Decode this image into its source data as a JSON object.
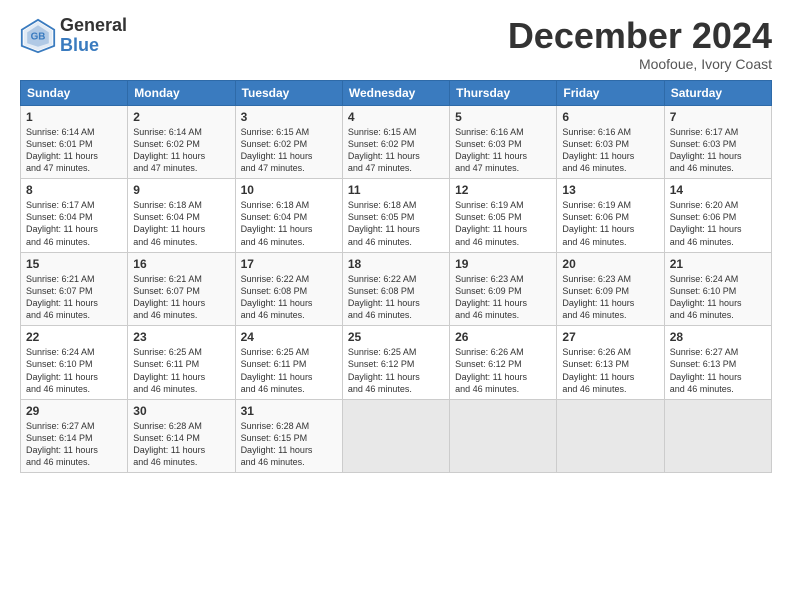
{
  "logo": {
    "general": "General",
    "blue": "Blue"
  },
  "title": "December 2024",
  "subtitle": "Moofoue, Ivory Coast",
  "days_of_week": [
    "Sunday",
    "Monday",
    "Tuesday",
    "Wednesday",
    "Thursday",
    "Friday",
    "Saturday"
  ],
  "weeks": [
    [
      {
        "day": 1,
        "info": "Sunrise: 6:14 AM\nSunset: 6:01 PM\nDaylight: 11 hours\nand 47 minutes."
      },
      {
        "day": 2,
        "info": "Sunrise: 6:14 AM\nSunset: 6:02 PM\nDaylight: 11 hours\nand 47 minutes."
      },
      {
        "day": 3,
        "info": "Sunrise: 6:15 AM\nSunset: 6:02 PM\nDaylight: 11 hours\nand 47 minutes."
      },
      {
        "day": 4,
        "info": "Sunrise: 6:15 AM\nSunset: 6:02 PM\nDaylight: 11 hours\nand 47 minutes."
      },
      {
        "day": 5,
        "info": "Sunrise: 6:16 AM\nSunset: 6:03 PM\nDaylight: 11 hours\nand 47 minutes."
      },
      {
        "day": 6,
        "info": "Sunrise: 6:16 AM\nSunset: 6:03 PM\nDaylight: 11 hours\nand 46 minutes."
      },
      {
        "day": 7,
        "info": "Sunrise: 6:17 AM\nSunset: 6:03 PM\nDaylight: 11 hours\nand 46 minutes."
      }
    ],
    [
      {
        "day": 8,
        "info": "Sunrise: 6:17 AM\nSunset: 6:04 PM\nDaylight: 11 hours\nand 46 minutes."
      },
      {
        "day": 9,
        "info": "Sunrise: 6:18 AM\nSunset: 6:04 PM\nDaylight: 11 hours\nand 46 minutes."
      },
      {
        "day": 10,
        "info": "Sunrise: 6:18 AM\nSunset: 6:04 PM\nDaylight: 11 hours\nand 46 minutes."
      },
      {
        "day": 11,
        "info": "Sunrise: 6:18 AM\nSunset: 6:05 PM\nDaylight: 11 hours\nand 46 minutes."
      },
      {
        "day": 12,
        "info": "Sunrise: 6:19 AM\nSunset: 6:05 PM\nDaylight: 11 hours\nand 46 minutes."
      },
      {
        "day": 13,
        "info": "Sunrise: 6:19 AM\nSunset: 6:06 PM\nDaylight: 11 hours\nand 46 minutes."
      },
      {
        "day": 14,
        "info": "Sunrise: 6:20 AM\nSunset: 6:06 PM\nDaylight: 11 hours\nand 46 minutes."
      }
    ],
    [
      {
        "day": 15,
        "info": "Sunrise: 6:21 AM\nSunset: 6:07 PM\nDaylight: 11 hours\nand 46 minutes."
      },
      {
        "day": 16,
        "info": "Sunrise: 6:21 AM\nSunset: 6:07 PM\nDaylight: 11 hours\nand 46 minutes."
      },
      {
        "day": 17,
        "info": "Sunrise: 6:22 AM\nSunset: 6:08 PM\nDaylight: 11 hours\nand 46 minutes."
      },
      {
        "day": 18,
        "info": "Sunrise: 6:22 AM\nSunset: 6:08 PM\nDaylight: 11 hours\nand 46 minutes."
      },
      {
        "day": 19,
        "info": "Sunrise: 6:23 AM\nSunset: 6:09 PM\nDaylight: 11 hours\nand 46 minutes."
      },
      {
        "day": 20,
        "info": "Sunrise: 6:23 AM\nSunset: 6:09 PM\nDaylight: 11 hours\nand 46 minutes."
      },
      {
        "day": 21,
        "info": "Sunrise: 6:24 AM\nSunset: 6:10 PM\nDaylight: 11 hours\nand 46 minutes."
      }
    ],
    [
      {
        "day": 22,
        "info": "Sunrise: 6:24 AM\nSunset: 6:10 PM\nDaylight: 11 hours\nand 46 minutes."
      },
      {
        "day": 23,
        "info": "Sunrise: 6:25 AM\nSunset: 6:11 PM\nDaylight: 11 hours\nand 46 minutes."
      },
      {
        "day": 24,
        "info": "Sunrise: 6:25 AM\nSunset: 6:11 PM\nDaylight: 11 hours\nand 46 minutes."
      },
      {
        "day": 25,
        "info": "Sunrise: 6:25 AM\nSunset: 6:12 PM\nDaylight: 11 hours\nand 46 minutes."
      },
      {
        "day": 26,
        "info": "Sunrise: 6:26 AM\nSunset: 6:12 PM\nDaylight: 11 hours\nand 46 minutes."
      },
      {
        "day": 27,
        "info": "Sunrise: 6:26 AM\nSunset: 6:13 PM\nDaylight: 11 hours\nand 46 minutes."
      },
      {
        "day": 28,
        "info": "Sunrise: 6:27 AM\nSunset: 6:13 PM\nDaylight: 11 hours\nand 46 minutes."
      }
    ],
    [
      {
        "day": 29,
        "info": "Sunrise: 6:27 AM\nSunset: 6:14 PM\nDaylight: 11 hours\nand 46 minutes."
      },
      {
        "day": 30,
        "info": "Sunrise: 6:28 AM\nSunset: 6:14 PM\nDaylight: 11 hours\nand 46 minutes."
      },
      {
        "day": 31,
        "info": "Sunrise: 6:28 AM\nSunset: 6:15 PM\nDaylight: 11 hours\nand 46 minutes."
      },
      null,
      null,
      null,
      null
    ]
  ]
}
